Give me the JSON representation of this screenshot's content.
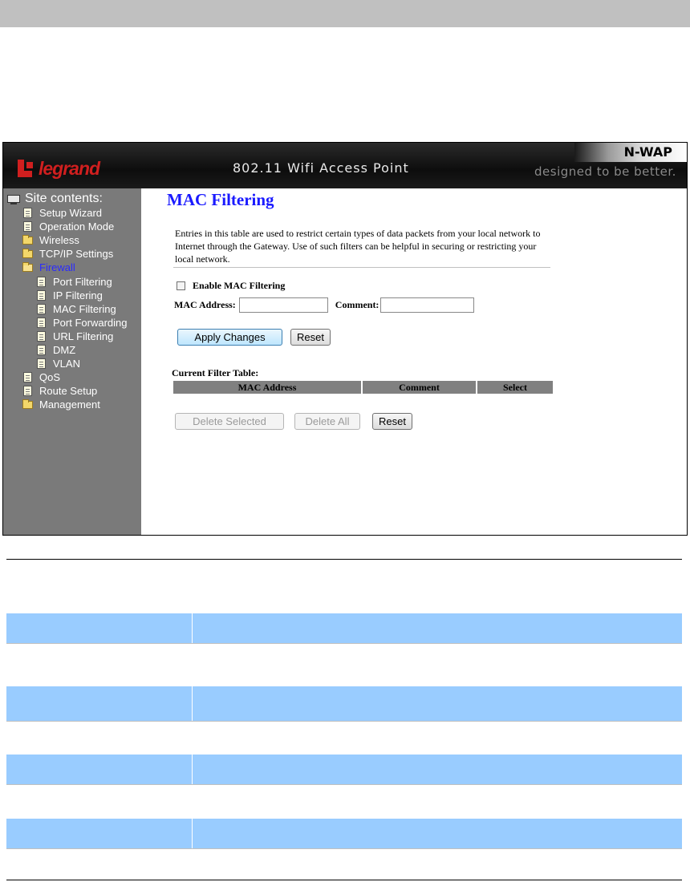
{
  "header": {
    "logo_text": "legrand",
    "title": "802.11 Wifi Access Point",
    "brand": "N-WAP",
    "tagline": "designed to be better."
  },
  "sidebar": {
    "root_label": "Site contents:",
    "items": [
      {
        "label": "Setup Wizard",
        "icon": "document-icon"
      },
      {
        "label": "Operation Mode",
        "icon": "document-icon"
      },
      {
        "label": "Wireless",
        "icon": "folder-icon"
      },
      {
        "label": "TCP/IP Settings",
        "icon": "folder-icon"
      },
      {
        "label": "Firewall",
        "icon": "open-folder-icon",
        "selected": true
      },
      {
        "label": "Port Filtering",
        "icon": "document-icon"
      },
      {
        "label": "IP Filtering",
        "icon": "document-icon"
      },
      {
        "label": "MAC Filtering",
        "icon": "document-icon"
      },
      {
        "label": "Port Forwarding",
        "icon": "document-icon"
      },
      {
        "label": "URL Filtering",
        "icon": "document-icon"
      },
      {
        "label": "DMZ",
        "icon": "document-icon"
      },
      {
        "label": "VLAN",
        "icon": "document-icon"
      },
      {
        "label": "QoS",
        "icon": "document-icon"
      },
      {
        "label": "Route Setup",
        "icon": "document-icon"
      },
      {
        "label": "Management",
        "icon": "folder-icon"
      }
    ]
  },
  "main": {
    "title": "MAC Filtering",
    "description": "Entries in this table are used to restrict certain types of data packets from your local network to Internet through the Gateway. Use of such filters can be helpful in securing or restricting your local network.",
    "enable_label": "Enable MAC Filtering",
    "mac_label": "MAC Address:",
    "mac_value": "",
    "comment_label": "Comment:",
    "comment_value": "",
    "apply_button": "Apply Changes",
    "reset_button": "Reset",
    "table_title": "Current Filter Table:",
    "columns": [
      "MAC Address",
      "Comment",
      "Select"
    ],
    "delete_selected_button": "Delete Selected",
    "delete_all_button": "Delete All",
    "reset_button_2": "Reset"
  },
  "colors": {
    "accent_title": "#1a1aff",
    "sidebar_bg": "#7a7a7a",
    "logo_red": "#d01f1f",
    "table_header": "#808080",
    "doc_row_blue": "#99ccff"
  }
}
